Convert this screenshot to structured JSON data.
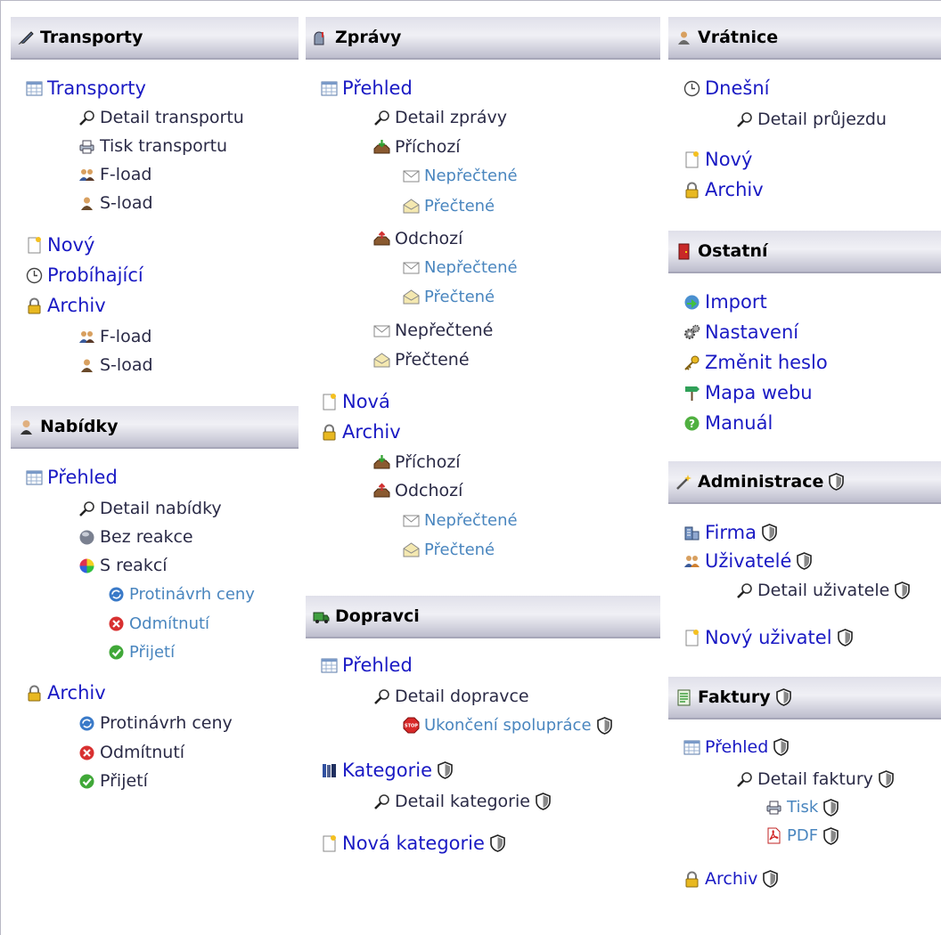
{
  "columns": {
    "transporty": {
      "title": "Transporty",
      "items": [
        "Transporty",
        "Detail transportu",
        "Tisk transportu",
        "F-load",
        "S-load",
        "Nový",
        "Probíhající",
        "Archiv",
        "F-load",
        "S-load"
      ]
    },
    "nabidky": {
      "title": "Nabídky",
      "items": [
        "Přehled",
        "Detail nabídky",
        "Bez reakce",
        "S reakcí",
        "Protinávrh ceny",
        "Odmítnutí",
        "Přijetí",
        "Archiv",
        "Protinávrh ceny",
        "Odmítnutí",
        "Přijetí"
      ]
    },
    "zpravy": {
      "title": "Zprávy",
      "items": [
        "Přehled",
        "Detail zprávy",
        "Příchozí",
        "Nepřečtené",
        "Přečtené",
        "Odchozí",
        "Nepřečtené",
        "Přečtené",
        "Nepřečtené",
        "Přečtené",
        "Nová",
        "Archiv",
        "Příchozí",
        "Odchozí",
        "Nepřečtené",
        "Přečtené"
      ]
    },
    "dopravci": {
      "title": "Dopravci",
      "items": [
        "Přehled",
        "Detail dopravce",
        "Ukončení spolupráce",
        "Kategorie",
        "Detail kategorie",
        "Nová kategorie"
      ]
    },
    "vratnice": {
      "title": "Vrátnice",
      "items": [
        "Dnešní",
        "Detail průjezdu",
        "Nový",
        "Archiv"
      ]
    },
    "ostatni": {
      "title": "Ostatní",
      "items": [
        "Import",
        "Nastavení",
        "Změnit heslo",
        "Mapa webu",
        "Manuál"
      ]
    },
    "administrace": {
      "title": "Administrace",
      "items": [
        "Firma",
        "Uživatelé",
        "Detail uživatele",
        "Nový uživatel"
      ]
    },
    "faktury": {
      "title": "Faktury",
      "items": [
        "Přehled",
        "Detail faktury",
        "Tisk",
        "PDF",
        "Archiv"
      ]
    }
  },
  "icons": [
    "table-icon",
    "magnifier-icon",
    "printer-icon",
    "users-icon",
    "user-icon",
    "new-document-icon",
    "clock-icon",
    "lock-icon",
    "person-icon",
    "gray-ball-icon",
    "color-wheel-icon",
    "cycle-icon",
    "reject-icon",
    "accept-icon",
    "inbox-in-icon",
    "inbox-out-icon",
    "envelope-icon",
    "envelope-open-icon",
    "truck-icon",
    "stop-icon",
    "books-icon",
    "door-icon",
    "import-icon",
    "gears-icon",
    "key-icon",
    "sign-icon",
    "help-icon",
    "wand-icon",
    "building-icon",
    "shield-icon",
    "invoice-icon",
    "pdf-icon",
    "mailbox-icon",
    "pen-icon"
  ],
  "colors": {
    "link_primary": "#1a1ac4",
    "link_secondary": "#4a86bf",
    "text_dark": "#2a2a46",
    "header_gradient_top": "#e0e0ea",
    "header_gradient_bottom": "#bdbdcd"
  }
}
